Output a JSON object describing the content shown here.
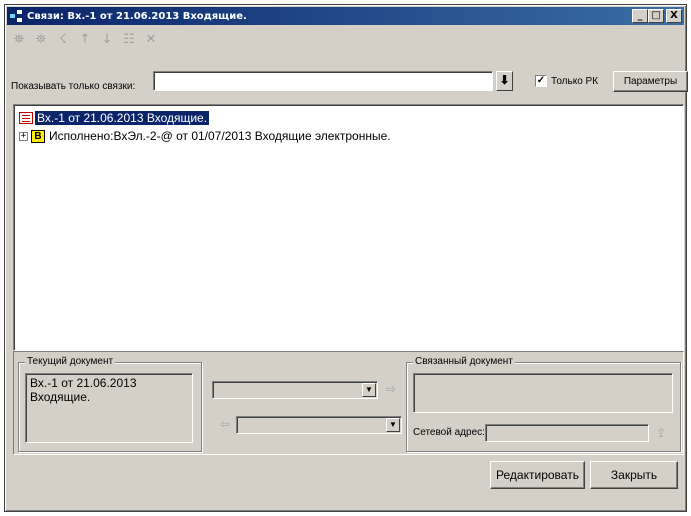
{
  "window": {
    "title": "Связи: Вх.-1 от 21.06.2013 Входящие.",
    "controls": {
      "minimize": "_",
      "maximize": "□",
      "close": "X"
    }
  },
  "toolbar": {
    "icons": [
      "add-link-icon",
      "add-child-link-icon",
      "link-icon",
      "move-up-icon",
      "move-down-icon",
      "properties-icon",
      "delete-icon"
    ],
    "glyphs": [
      "⛯",
      "⛯",
      "☇",
      "↑",
      "↓",
      "☷",
      "✕"
    ]
  },
  "filter": {
    "label": "Показывать только связки:",
    "value": "",
    "apply_glyph": "⬇",
    "only_rk_label": "Только РК",
    "only_rk_checked": true,
    "params_button": "Параметры"
  },
  "tree": {
    "items": [
      {
        "label": "Вх.-1 от 21.06.2013 Входящие.",
        "selected": true,
        "icon": "document-icon"
      },
      {
        "label": "Исполнено:ВхЭл.-2-@ от 01/07/2013 Входящие электронные.",
        "expander": "+",
        "badge": "В",
        "selected": false
      }
    ]
  },
  "current_document": {
    "legend": "Текущий документ",
    "text_line1": "Вх.-1 от 21.06.2013",
    "text_line2": "Входящие."
  },
  "related_document": {
    "legend": "Связанный документ",
    "network_address_label": "Сетевой адрес:",
    "network_address_value": ""
  },
  "link_type": {
    "forward_value": "",
    "backward_value": "",
    "forward_arrow": "⇨",
    "backward_arrow": "⇦"
  },
  "actions": {
    "edit": "Редактировать",
    "close": "Закрыть"
  },
  "colors": {
    "title_gradient_start": "#0a246a",
    "title_gradient_end": "#3a6ea5",
    "face": "#d4d0c8",
    "selection": "#0a246a"
  }
}
